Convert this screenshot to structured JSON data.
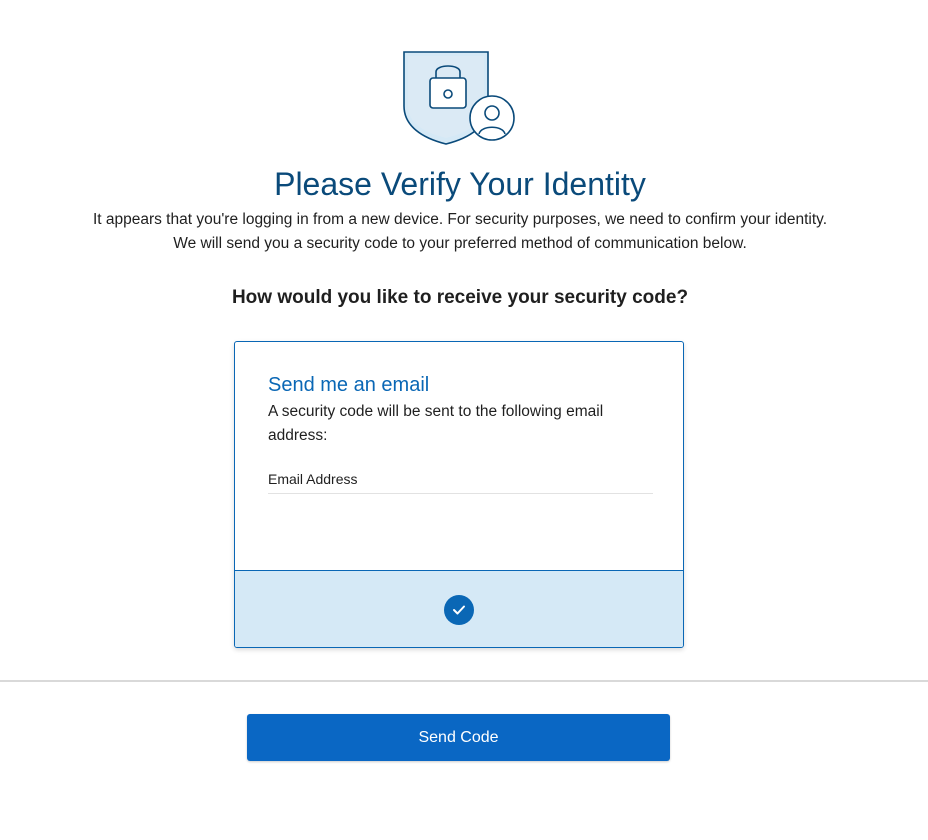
{
  "header": {
    "icon": "shield-lock-user-icon",
    "title": "Please Verify Your Identity",
    "intro_line1": "It appears that you're logging in from a new device. For security purposes, we need to confirm your identity.",
    "intro_line2": "We will send you a security code to your preferred method of communication below."
  },
  "question": "How would you like to receive your security code?",
  "option": {
    "title": "Send me an email",
    "description": "A security code will be sent to the following email address:",
    "field_label": "Email Address",
    "selected": true,
    "selected_icon": "check-circle-icon"
  },
  "actions": {
    "send_label": "Send Code"
  },
  "colors": {
    "title": "#0a4a7a",
    "accent": "#0a67b5",
    "selected_bg": "#d5e9f6",
    "button": "#0a67c4"
  }
}
